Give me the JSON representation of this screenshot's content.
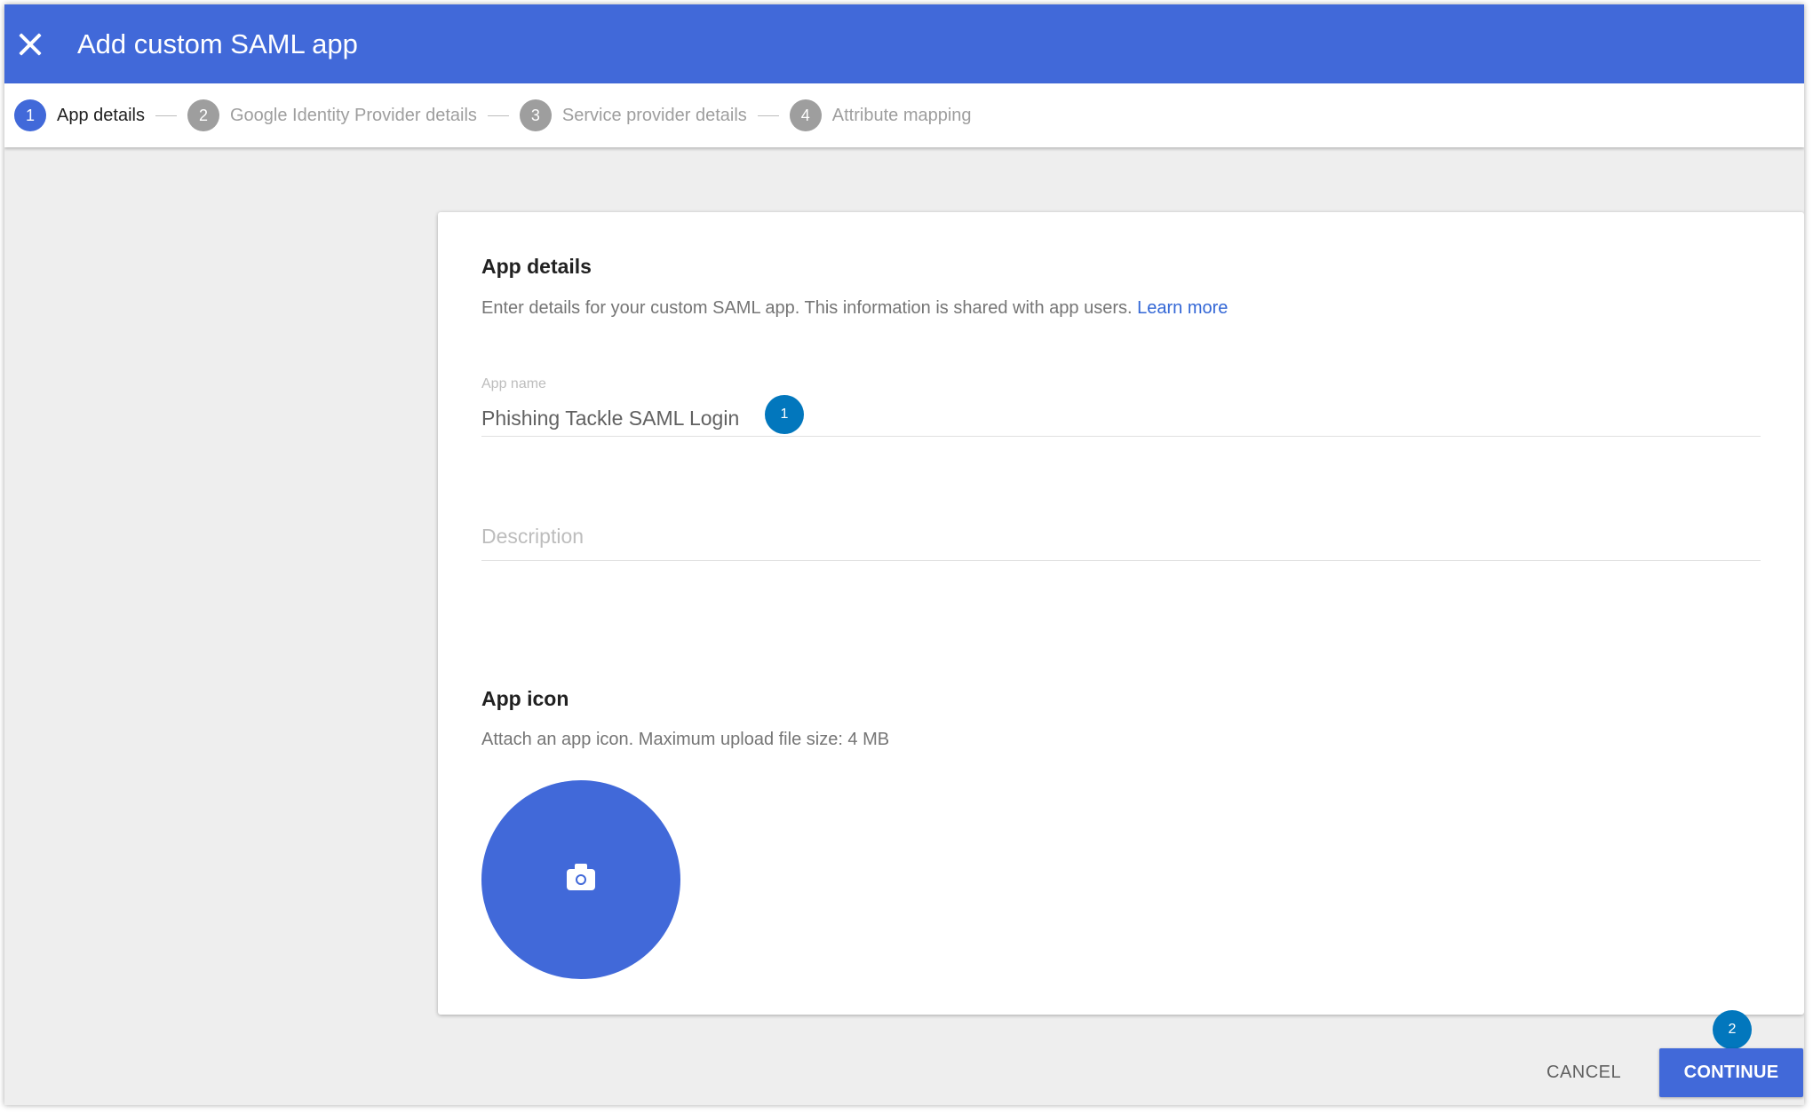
{
  "header": {
    "close_icon": "close-icon",
    "title": "Add custom SAML app",
    "bar_color": "#4169d9"
  },
  "steps": [
    {
      "number": "1",
      "label": "App details",
      "active": true
    },
    {
      "number": "2",
      "label": "Google Identity Provider details",
      "active": false
    },
    {
      "number": "3",
      "label": "Service provider details",
      "active": false
    },
    {
      "number": "4",
      "label": "Attribute mapping",
      "active": false
    }
  ],
  "app_details": {
    "title": "App details",
    "description": "Enter details for your custom SAML app. This information is shared with app users.",
    "learn_more": "Learn more",
    "app_name_label": "App name",
    "app_name_value": "Phishing Tackle SAML Login",
    "description_placeholder": "Description"
  },
  "app_icon": {
    "title": "App icon",
    "description": "Attach an app icon. Maximum upload file size: 4 MB",
    "upload_icon": "camera-icon"
  },
  "annotations": [
    "1",
    "2"
  ],
  "actions": {
    "cancel": "CANCEL",
    "continue": "CONTINUE"
  }
}
